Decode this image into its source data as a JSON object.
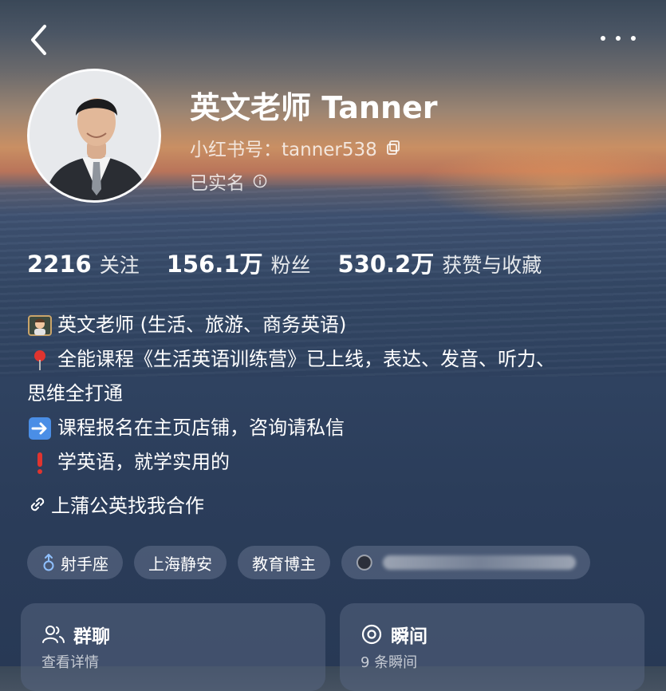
{
  "profile": {
    "name": "英文老师 Tanner",
    "id_label": "小红书号：tanner538",
    "verified_label": "已实名"
  },
  "stats": [
    {
      "num": "2216",
      "label": "关注"
    },
    {
      "num": "156.1万",
      "label": "粉丝"
    },
    {
      "num": "530.2万",
      "label": "获赞与收藏"
    }
  ],
  "bio": {
    "line1": "英文老师 (生活、旅游、商务英语)",
    "line2": "全能课程《生活英语训练营》已上线，表达、发音、听力、",
    "line3": "思维全打通",
    "line4": "课程报名在主页店铺，咨询请私信",
    "line5": "学英语，就学实用的"
  },
  "collab_link": "上蒲公英找我合作",
  "tags": {
    "zodiac": "射手座",
    "location": "上海静安",
    "role": "教育博主"
  },
  "cards": {
    "group_title": "群聊",
    "group_sub": "查看详情",
    "moments_title": "瞬间",
    "moments_sub": "9 条瞬间"
  },
  "icons": {
    "back": "chevron-left-icon",
    "more": "more-dots-icon",
    "copy": "copy-icon",
    "info": "info-icon",
    "link": "link-icon",
    "male": "male-icon",
    "group": "users-icon",
    "moments": "target-icon"
  }
}
